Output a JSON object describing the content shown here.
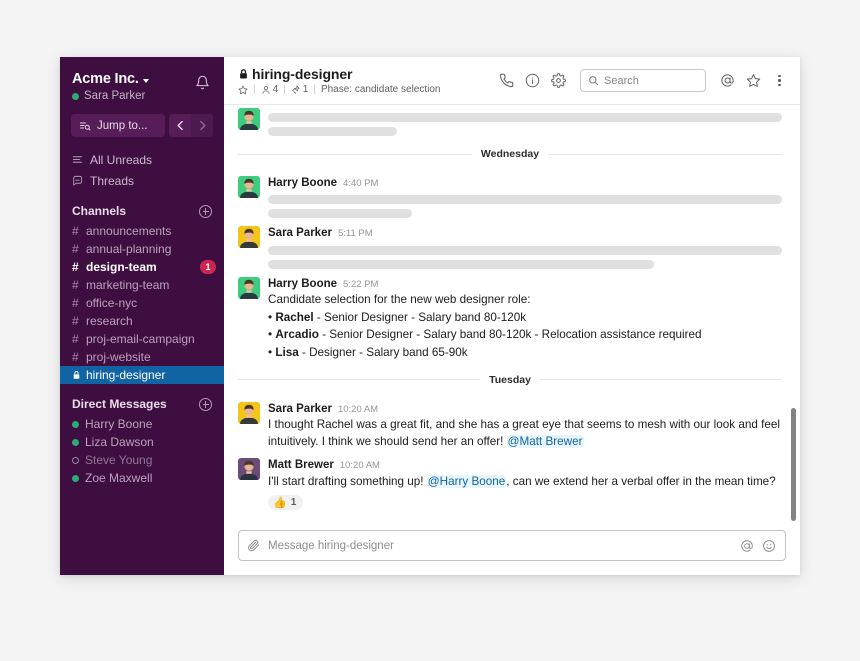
{
  "sidebar": {
    "team_name": "Acme Inc.",
    "team_caret_icon": "chevron-down-icon",
    "notifications_icon": "bell-icon",
    "current_user": "Sara Parker",
    "current_user_presence": "active",
    "jump_to_label": "Jump to...",
    "jump_to_icon": "jump-to-icon",
    "nav_back_icon": "chevron-left-icon",
    "nav_forward_icon": "chevron-right-icon",
    "links": [
      {
        "label": "All Unreads",
        "icon": "unreads-icon"
      },
      {
        "label": "Threads",
        "icon": "threads-icon"
      }
    ],
    "channels_section": {
      "title": "Channels",
      "add_icon": "plus-circle-icon",
      "items": [
        {
          "name": "announcements",
          "prefix": "#",
          "state": "normal",
          "badge": null
        },
        {
          "name": "annual-planning",
          "prefix": "#",
          "state": "normal",
          "badge": null
        },
        {
          "name": "design-team",
          "prefix": "#",
          "state": "unread",
          "badge": "1"
        },
        {
          "name": "marketing-team",
          "prefix": "#",
          "state": "normal",
          "badge": null
        },
        {
          "name": "office-nyc",
          "prefix": "#",
          "state": "normal",
          "badge": null
        },
        {
          "name": "research",
          "prefix": "#",
          "state": "normal",
          "badge": null
        },
        {
          "name": "proj-email-campaign",
          "prefix": "#",
          "state": "normal",
          "badge": null
        },
        {
          "name": "proj-website",
          "prefix": "#",
          "state": "normal",
          "badge": null
        },
        {
          "name": "hiring-designer",
          "prefix": "lock",
          "state": "active",
          "badge": null
        }
      ]
    },
    "dms_section": {
      "title": "Direct Messages",
      "add_icon": "plus-circle-icon",
      "items": [
        {
          "name": "Harry Boone",
          "presence": "active"
        },
        {
          "name": "Liza Dawson",
          "presence": "active"
        },
        {
          "name": "Steve Young",
          "presence": "away"
        },
        {
          "name": "Zoe Maxwell",
          "presence": "active"
        }
      ]
    }
  },
  "header": {
    "channel_name": "hiring-designer",
    "channel_private_icon": "lock-icon",
    "star_icon": "star-outline-icon",
    "members_icon": "person-icon",
    "members_count": "4",
    "pins_icon": "pin-icon",
    "pins_count": "1",
    "topic": "Phase: candidate selection",
    "call_icon": "phone-icon",
    "info_icon": "info-circle-icon",
    "settings_icon": "gear-icon",
    "search": {
      "icon": "search-icon",
      "placeholder": "Search",
      "value": ""
    },
    "mentions_icon": "at-icon",
    "starred_icon": "star-outline-icon",
    "more_icon": "kebab-menu-icon"
  },
  "messages": {
    "top_partial": {
      "author": "",
      "time": "",
      "redacted_lines": [
        2
      ]
    },
    "groups": [
      {
        "divider": "Wednesday",
        "items": [
          {
            "author": "Harry Boone",
            "time": "4:40 PM",
            "avatar_bg": "#3ECD7E",
            "redacted": true,
            "redacted_widths": [
              "100%",
              "28%"
            ],
            "lines": []
          },
          {
            "author": "Sara Parker",
            "time": "5:11 PM",
            "avatar_bg": "#F5C419",
            "redacted": true,
            "redacted_widths": [
              "100%",
              "75%"
            ],
            "lines": []
          },
          {
            "author": "Harry Boone",
            "time": "5:22 PM",
            "avatar_bg": "#3ECD7E",
            "redacted": false,
            "lines": [
              {
                "type": "text",
                "text": "Candidate selection for the new web designer role:"
              },
              {
                "type": "bullet",
                "bold": "Rachel",
                "text": " - Senior Designer - Salary band 80-120k"
              },
              {
                "type": "bullet",
                "bold": "Arcadio",
                "text": " - Senior Designer - Salary band 80-120k - Relocation assistance required"
              },
              {
                "type": "bullet",
                "bold": "Lisa",
                "text": " - Designer - Salary band 65-90k"
              }
            ]
          }
        ]
      },
      {
        "divider": "Tuesday",
        "items": [
          {
            "author": "Sara Parker",
            "time": "10:20 AM",
            "avatar_bg": "#F5C419",
            "redacted": false,
            "lines": [
              {
                "type": "rich",
                "pre": "I thought Rachel was a great fit, and she has a great eye that seems to mesh with our look and feel intuitively. I think we should send her an offer! ",
                "mention": "@Matt Brewer",
                "post": ""
              }
            ]
          },
          {
            "author": "Matt Brewer",
            "time": "10:20 AM",
            "avatar_bg": "#6B4C77",
            "redacted": false,
            "lines": [
              {
                "type": "rich",
                "pre": "I'll start drafting something up! ",
                "mention": "@Harry Boone",
                "post": ", can we extend her a verbal offer in the mean time?"
              }
            ],
            "reaction": {
              "emoji": "👍",
              "count": "1"
            }
          }
        ]
      }
    ]
  },
  "composer": {
    "attach_icon": "paperclip-icon",
    "placeholder": "Message hiring-designer",
    "value": "",
    "mention_icon": "at-icon",
    "emoji_icon": "smiley-icon"
  },
  "colors": {
    "sidebar_bg": "#3F0E40",
    "active_channel_bg": "#1164A3",
    "badge_bg": "#CD2553",
    "mention_text": "#1264A3",
    "presence_green": "#2BAC76"
  }
}
